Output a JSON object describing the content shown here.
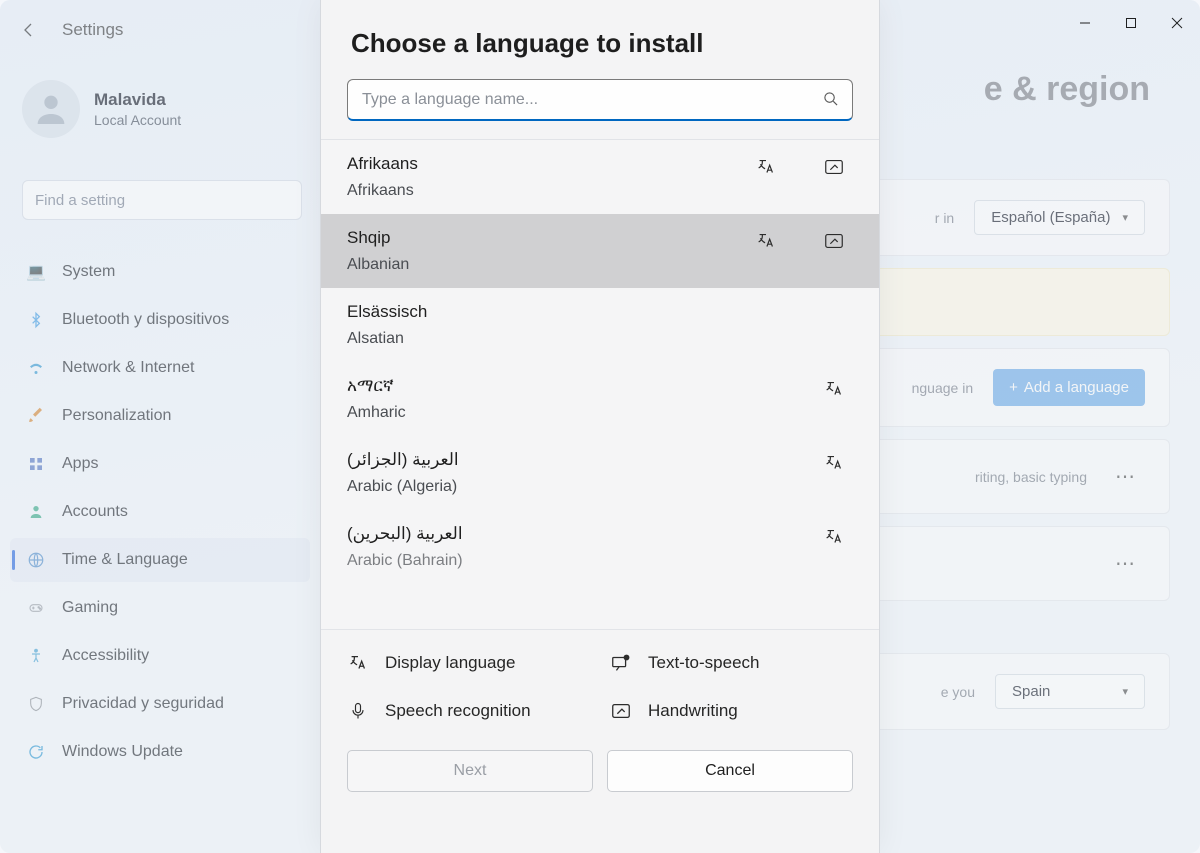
{
  "window": {
    "app": "Settings"
  },
  "profile": {
    "name": "Malavida",
    "account_type": "Local Account"
  },
  "search": {
    "placeholder": "Find a setting"
  },
  "sidebar": {
    "items": [
      {
        "label": "System",
        "icon": "💻",
        "color": "#3c8fd9"
      },
      {
        "label": "Bluetooth y dispositivos",
        "icon": "bt",
        "color": "#4aa3e6"
      },
      {
        "label": "Network & Internet",
        "icon": "wifi",
        "color": "#3c9fd6"
      },
      {
        "label": "Personalization",
        "icon": "brush",
        "color": "#d98e3c"
      },
      {
        "label": "Apps",
        "icon": "apps",
        "color": "#5b7cc7"
      },
      {
        "label": "Accounts",
        "icon": "person",
        "color": "#3fae8d"
      },
      {
        "label": "Time & Language",
        "icon": "globe",
        "color": "#5792d0",
        "active": true
      },
      {
        "label": "Gaming",
        "icon": "game",
        "color": "#9aa0a8"
      },
      {
        "label": "Accessibility",
        "icon": "access",
        "color": "#4fa8d8"
      },
      {
        "label": "Privacidad y seguridad",
        "icon": "shield",
        "color": "#8f949b"
      },
      {
        "label": "Windows Update",
        "icon": "update",
        "color": "#3aa0d8"
      }
    ]
  },
  "page": {
    "title_fragment": "e & region",
    "lang_dropdown_value": "Español (España)",
    "desc_fragment_1": "r in",
    "desc_fragment_2": "nguage in",
    "add_language_label": "Add a language",
    "pref_sub_fragment": "riting, basic typing",
    "country_label_fragment": "e you",
    "country_value": "Spain"
  },
  "modal": {
    "title": "Choose a language to install",
    "search_placeholder": "Type a language name...",
    "languages": [
      {
        "native": "Afrikaans",
        "english": "Afrikaans",
        "display": true,
        "handwriting": true
      },
      {
        "native": "Shqip",
        "english": "Albanian",
        "display": true,
        "handwriting": true,
        "selected": true
      },
      {
        "native": "Elsässisch",
        "english": "Alsatian"
      },
      {
        "native": "አማርኛ",
        "english": "Amharic",
        "display": true
      },
      {
        "native": "العربية (الجزائر)",
        "english": "Arabic (Algeria)",
        "display": true
      },
      {
        "native": "العربية (البحرين)",
        "english": "Arabic (Bahrain)",
        "display": true,
        "cut": true
      }
    ],
    "legend": {
      "display": "Display language",
      "tts": "Text-to-speech",
      "speech": "Speech recognition",
      "handwriting": "Handwriting"
    },
    "buttons": {
      "next": "Next",
      "cancel": "Cancel"
    }
  }
}
